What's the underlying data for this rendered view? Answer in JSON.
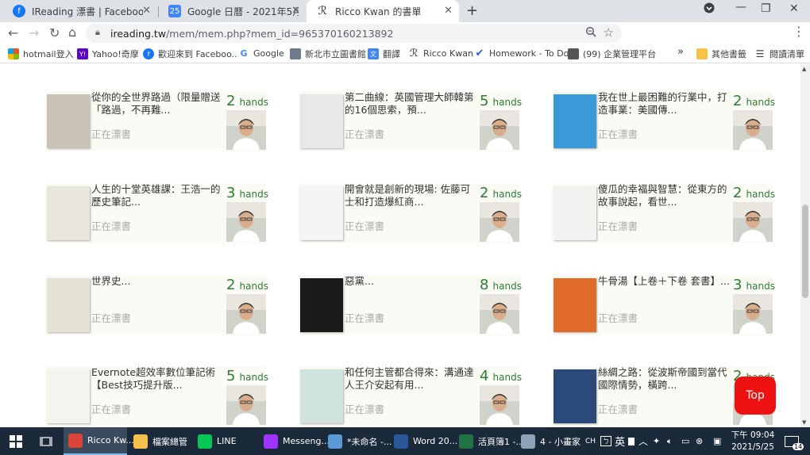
{
  "browser": {
    "tabs": [
      {
        "title": "IReading 漂書 | Facebook",
        "icon": "facebook-icon",
        "color": "#1877f2"
      },
      {
        "title": "Google 日曆 - 2021年5月24日至...",
        "icon": "calendar-icon",
        "color": "#4285f4"
      },
      {
        "title": "Ricco Kwan 的書單",
        "icon": "ireading-icon",
        "color": "#222222"
      }
    ],
    "new_tab_symbol": "+",
    "url_host": "ireading.tw",
    "url_path": "/mem/mem.php?mem_id=965370160213892",
    "avatar_letter": "R",
    "bookmarks": [
      {
        "label": "hotmail登入",
        "icon": "windows-icon",
        "color": "#e74c3c"
      },
      {
        "label": "Yahoo!奇摩",
        "icon": "yahoo-icon",
        "color": "#5f01d1"
      },
      {
        "label": "歡迎來到 Faceboo...",
        "icon": "facebook-icon",
        "color": "#1877f2"
      },
      {
        "label": "Google",
        "icon": "google-icon",
        "color": "#4285f4"
      },
      {
        "label": "新北市立圖書館",
        "icon": "library-icon",
        "color": "#6d7b8a"
      },
      {
        "label": "翻譯",
        "icon": "translate-icon",
        "color": "#4285f4"
      },
      {
        "label": "Ricco Kwan",
        "icon": "ireading-icon",
        "color": "#222222"
      },
      {
        "label": "Homework - To Do",
        "icon": "todo-check-icon",
        "color": "#2564cf"
      },
      {
        "label": "(99) 企業管理平台",
        "icon": "platform-icon",
        "color": "#555555"
      }
    ],
    "bookmarks_more": "»",
    "other_bookmarks": "其他書籤",
    "reading_list": "閱讀清單"
  },
  "books": [
    {
      "title": "從你的全世界路過（限量贈送「路過，不再難...",
      "count": "2",
      "unit": "hands",
      "status": "正在漂書",
      "cover_color": "#c9c3b5"
    },
    {
      "title": "第二曲線：英國管理大師韓第的16個思索，預...",
      "count": "5",
      "unit": "hands",
      "status": "正在漂書",
      "cover_color": "#e8e8e8"
    },
    {
      "title": "我在世上最困難的行業中，打造事業：美國傳...",
      "count": "2",
      "unit": "hands",
      "status": "正在漂書",
      "cover_color": "#3a9ad9"
    },
    {
      "title": "人生的十堂英雄課：王浩一的歷史筆記...",
      "count": "3",
      "unit": "hands",
      "status": "正在漂書",
      "cover_color": "#e9e6dc"
    },
    {
      "title": "開會就是創新的現場: 佐藤可士和打造爆紅商...",
      "count": "2",
      "unit": "hands",
      "status": "正在漂書",
      "cover_color": "#f5f5f5"
    },
    {
      "title": "傻瓜的幸福與智慧：從東方的故事說起，看世...",
      "count": "2",
      "unit": "hands",
      "status": "正在漂書",
      "cover_color": "#f2f2f0"
    },
    {
      "title": "世界史...",
      "count": "2",
      "unit": "hands",
      "status": "正在漂書",
      "cover_color": "#e6e2d6"
    },
    {
      "title": "惡黨...",
      "count": "8",
      "unit": "hands",
      "status": "正在漂書",
      "cover_color": "#1a1a1a"
    },
    {
      "title": "牛骨湯【上卷＋下卷 套書】...",
      "count": "3",
      "unit": "hands",
      "status": "正在漂書",
      "cover_color": "#e06a2a"
    },
    {
      "title": "Evernote超效率數位筆記術【Best技巧提升版...",
      "count": "5",
      "unit": "hands",
      "status": "正在漂書",
      "cover_color": "#f4f4ee"
    },
    {
      "title": "和任何主管都合得來：溝通達人王介安起有用...",
      "count": "4",
      "unit": "hands",
      "status": "正在漂書",
      "cover_color": "#cfe2de"
    },
    {
      "title": "絲綢之路：從波斯帝國到當代國際情勢，橫跨...",
      "count": "2",
      "unit": "hands",
      "status": "正在漂書",
      "cover_color": "#2b4a7a"
    }
  ],
  "top_button": "Top",
  "taskbar": {
    "items": [
      {
        "label": "Ricco Kw...",
        "icon": "chrome-icon",
        "color": "#db4437"
      },
      {
        "label": "檔案總管",
        "icon": "folder-icon",
        "color": "#f2c14e"
      },
      {
        "label": "LINE",
        "icon": "line-icon",
        "color": "#06c755"
      },
      {
        "label": "Messeng...",
        "icon": "messenger-icon",
        "color": "#a033ff"
      },
      {
        "label": "*未命名 -...",
        "icon": "notepad-icon",
        "color": "#5b9bd5"
      },
      {
        "label": "Word 20...",
        "icon": "word-icon",
        "color": "#2b579a"
      },
      {
        "label": "活頁簿1 -...",
        "icon": "excel-icon",
        "color": "#217346"
      },
      {
        "label": "4 - 小畫家",
        "icon": "paint-icon",
        "color": "#8fa3b8"
      }
    ],
    "ime_lang": "CH",
    "ime_mode": "英",
    "time": "下午 09:04",
    "date": "2021/5/25",
    "notification_count": "14"
  }
}
